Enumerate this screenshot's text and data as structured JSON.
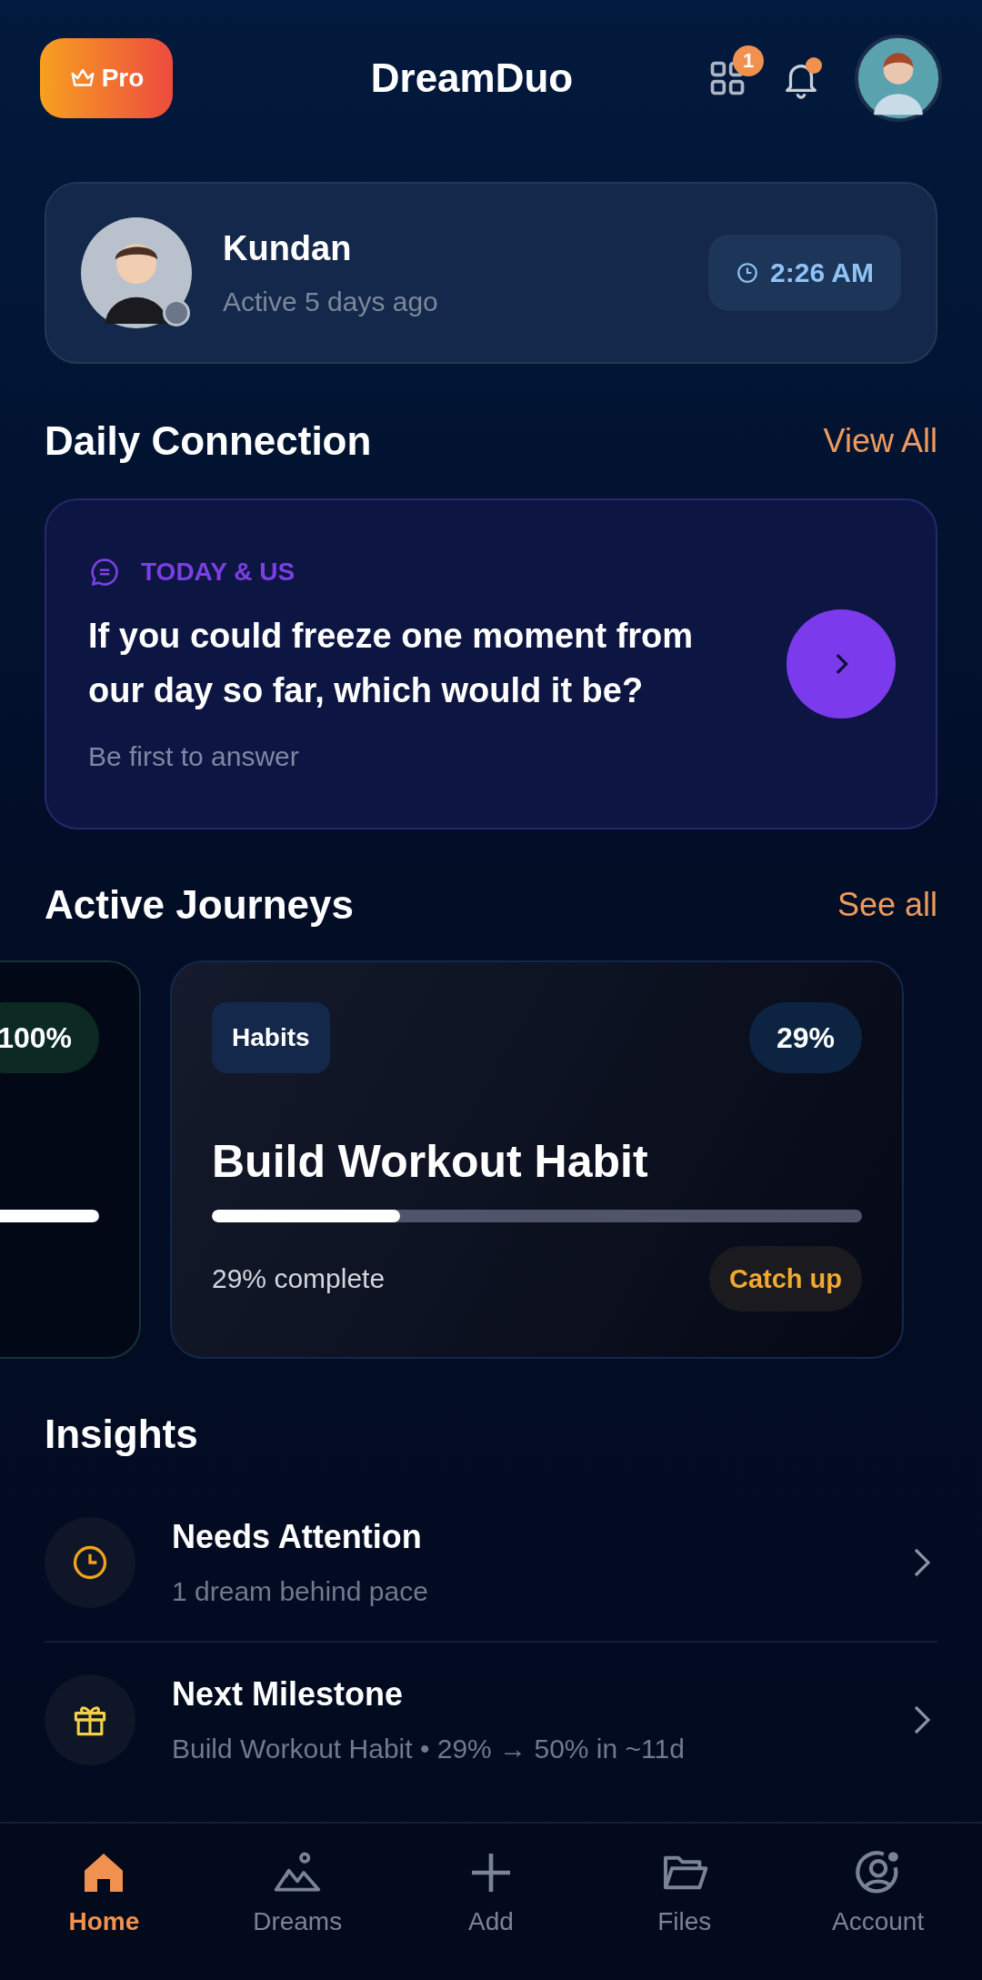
{
  "header": {
    "pro_button": "Pro",
    "title": "DreamDuo",
    "grid_badge": "1",
    "bell_unread": true
  },
  "partner": {
    "name": "Kundan",
    "status": "Active 5 days ago",
    "online": false,
    "time": "2:26 AM"
  },
  "daily_connection": {
    "heading": "Daily Connection",
    "link": "View All",
    "category": "TODAY & US",
    "question": "If you could freeze one moment from our day so far, which would it be?",
    "hint": "Be first to answer"
  },
  "journeys": {
    "heading": "Active Journeys",
    "link": "See all",
    "cards": [
      {
        "kind": "complete",
        "percent": "100%",
        "level": 1
      },
      {
        "kind": "active",
        "category": "Habits",
        "percent": "29%",
        "title": "Build Workout Habit",
        "level": 0.29,
        "caption": "29% complete",
        "action": "Catch up"
      }
    ]
  },
  "insights": {
    "heading": "Insights",
    "items": [
      {
        "title": "Needs Attention",
        "detail": "1 dream behind pace"
      },
      {
        "title": "Next Milestone",
        "detail": "Build Workout Habit • 29% → 50% in ~11d"
      }
    ]
  },
  "nav": [
    {
      "label": "Home",
      "selected": true
    },
    {
      "label": "Dreams",
      "selected": false
    },
    {
      "label": "Add",
      "selected": false
    },
    {
      "label": "Files",
      "selected": false
    },
    {
      "label": "Account",
      "selected": false
    }
  ]
}
